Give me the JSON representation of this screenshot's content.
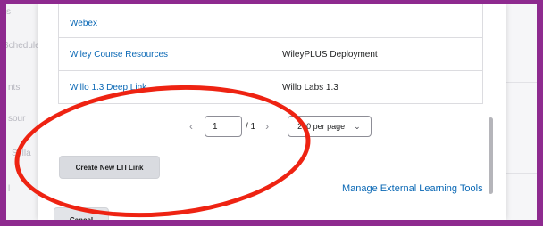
{
  "background_page": {
    "sidebar_items": [
      "s",
      "Schedule",
      "nts",
      "sour",
      "Sylla",
      "l"
    ]
  },
  "tools_table": {
    "rows": [
      {
        "name": "Webex",
        "deployment": ""
      },
      {
        "name": "Wiley Course Resources",
        "deployment": "WileyPLUS Deployment"
      },
      {
        "name": "Willo 1.3 Deep Link",
        "deployment": "Willo Labs 1.3"
      }
    ]
  },
  "pagination": {
    "current_page": "1",
    "total_label": "/ 1",
    "per_page_label": "200 per page",
    "prev_icon": "chevron-left-icon",
    "next_icon": "chevron-right-icon"
  },
  "actions": {
    "create_label": "Create New LTI Link",
    "manage_label": "Manage External Learning Tools",
    "cancel_label": "Cancel"
  },
  "colors": {
    "frame": "#8e2a8f",
    "link": "#0a68b5",
    "annotation": "#ee2312"
  }
}
